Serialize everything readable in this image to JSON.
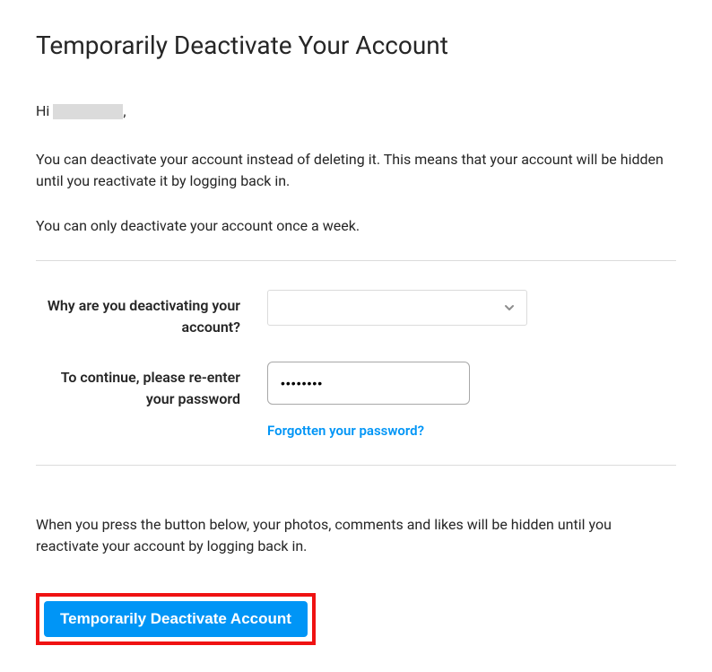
{
  "title": "Temporarily Deactivate Your Account",
  "greeting_prefix": "Hi ",
  "greeting_suffix": ",",
  "intro_paragraph": "You can deactivate your account instead of deleting it. This means that your account will be hidden until you reactivate it by logging back in.",
  "limit_paragraph": "You can only deactivate your account once a week.",
  "form": {
    "reason_label": "Why are you deactivating your account?",
    "reason_value": "",
    "password_label": "To continue, please re-enter your password",
    "password_value": "••••••••",
    "forgot_password_link": "Forgotten your password?"
  },
  "hidden_note": "When you press the button below, your photos, comments and likes will be hidden until you reactivate your account by logging back in.",
  "action_button": "Temporarily Deactivate Account",
  "colors": {
    "accent": "#0095f6",
    "highlight_border": "#ef1212"
  }
}
